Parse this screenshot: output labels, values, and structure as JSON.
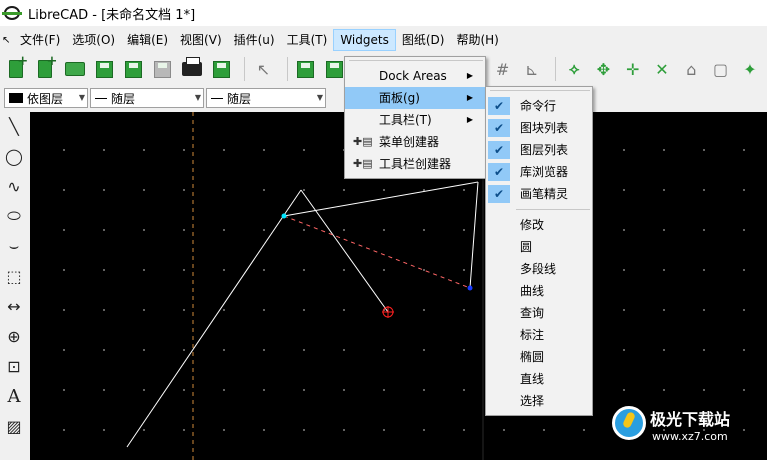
{
  "window": {
    "title": "LibreCAD - [未命名文档 1*]"
  },
  "menubar": {
    "lead_icon": "cursor-icon",
    "items": [
      "文件(F)",
      "选项(O)",
      "编辑(E)",
      "视图(V)",
      "插件(u)",
      "工具(T)",
      "Widgets",
      "图纸(D)",
      "帮助(H)"
    ],
    "active": "Widgets"
  },
  "toolbar": {
    "icons": [
      "new-document-icon",
      "new-from-template-icon",
      "open-folder-icon",
      "save-icon",
      "save-as-icon",
      "save-all-icon",
      "print-icon",
      "print-preview-icon",
      "select-pointer-icon",
      "undo-icon",
      "redo-icon",
      "grid-icon",
      "dimension-icon",
      "snap-free-icon",
      "snap-grid-icon",
      "snap-endpoint-icon",
      "snap-center-icon",
      "restrict-icon",
      "zoom-icon",
      "relative-zero-icon"
    ]
  },
  "layerbar": {
    "layer": "依图层",
    "line_type": "随层",
    "line_width": "随层"
  },
  "left_tools": [
    "line-tool-icon",
    "circle-tool-icon",
    "spline-tool-icon",
    "ellipse-tool-icon",
    "polyline-tool-icon",
    "select-tool-icon",
    "dimension-tool-icon",
    "modify-tool-icon",
    "measure-tool-icon",
    "text-tool-icon",
    "hatch-tool-icon"
  ],
  "widgets_menu": {
    "items": [
      {
        "label": "Dock Areas",
        "has_submenu": true,
        "highlight": false
      },
      {
        "label": "面板(g)",
        "has_submenu": true,
        "highlight": true
      },
      {
        "label": "工具栏(T)",
        "has_submenu": true,
        "highlight": false
      },
      {
        "label": "菜单创建器",
        "has_submenu": false,
        "highlight": false,
        "icon": "menu-creator-icon"
      },
      {
        "label": "工具栏创建器",
        "has_submenu": false,
        "highlight": false,
        "icon": "toolbar-creator-icon"
      }
    ]
  },
  "panels_menu": {
    "checked": [
      {
        "label": "命令行",
        "checked": true
      },
      {
        "label": "图块列表",
        "checked": true
      },
      {
        "label": "图层列表",
        "checked": true
      },
      {
        "label": "库浏览器",
        "checked": true
      },
      {
        "label": "画笔精灵",
        "checked": true
      }
    ],
    "unchecked": [
      "修改",
      "圆",
      "多段线",
      "曲线",
      "查询",
      "标注",
      "椭圆",
      "直线",
      "选择"
    ]
  },
  "colors": {
    "canvas_bg": "#000000",
    "menu_highlight": "#91c9f7",
    "active_menu": "#cce8ff",
    "preview_line": "#ff6666",
    "selected_point": "#00e5ff",
    "blue_point": "#1a3cff",
    "red_marker": "#ff2020"
  },
  "watermark": {
    "title": "极光下载站",
    "url": "www.xz7.com"
  }
}
